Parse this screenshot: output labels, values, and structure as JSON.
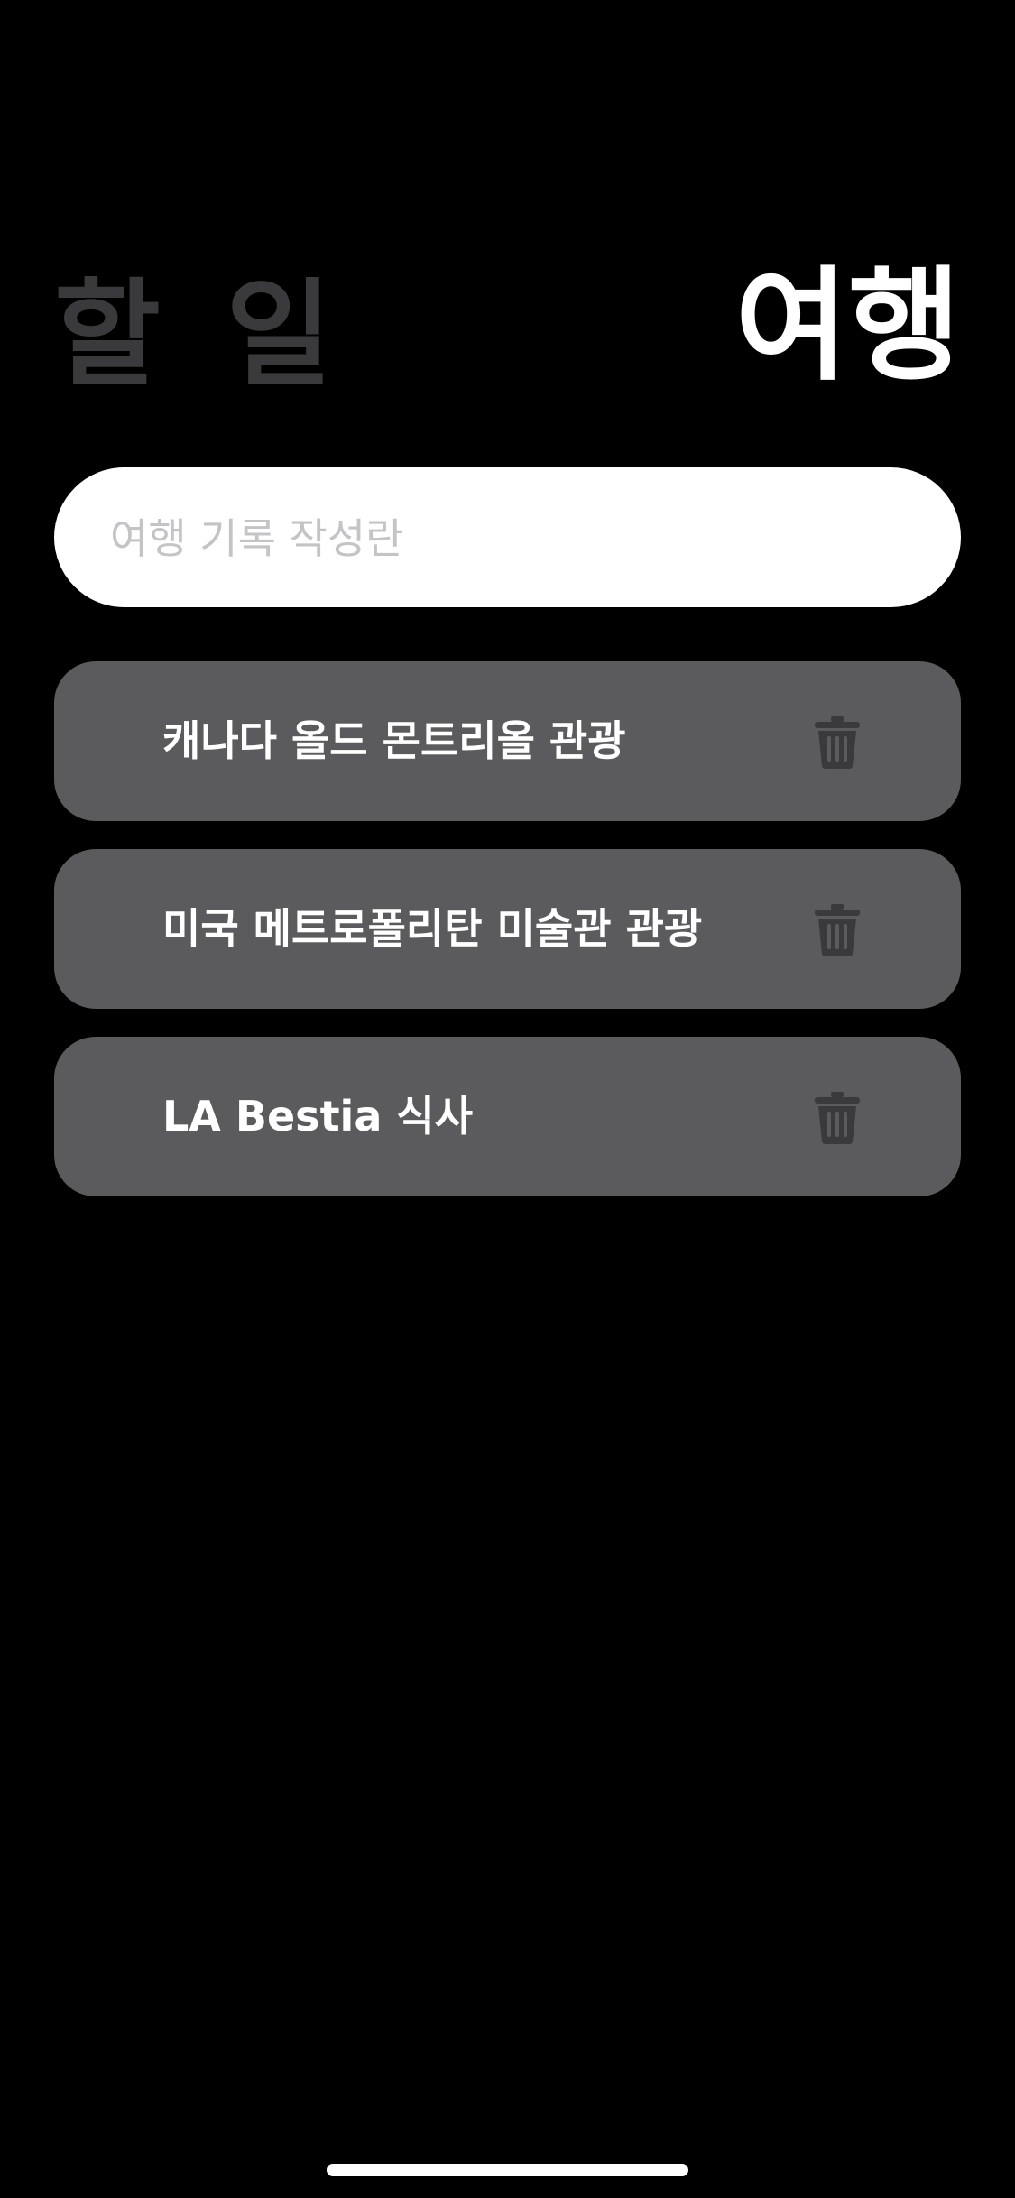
{
  "header": {
    "tab_todo_label": "할 일",
    "tab_travel_label": "여행",
    "active_tab": "여행"
  },
  "input": {
    "placeholder": "여행 기록 작성란",
    "value": ""
  },
  "items": [
    {
      "label": "캐나다 올드 몬트리올 관광",
      "icon": "trash-icon"
    },
    {
      "label": "미국 메트로폴리탄 미술관 관광",
      "icon": "trash-icon"
    },
    {
      "label": "LA Bestia 식사",
      "icon": "trash-icon"
    }
  ],
  "colors": {
    "background": "#000000",
    "active_tab": "#ffffff",
    "inactive_tab": "#3a3a3c",
    "item_background": "#5b5b5e",
    "trash_icon": "#3a3a3c",
    "input_background": "#ffffff",
    "placeholder": "#c4c4c6"
  }
}
